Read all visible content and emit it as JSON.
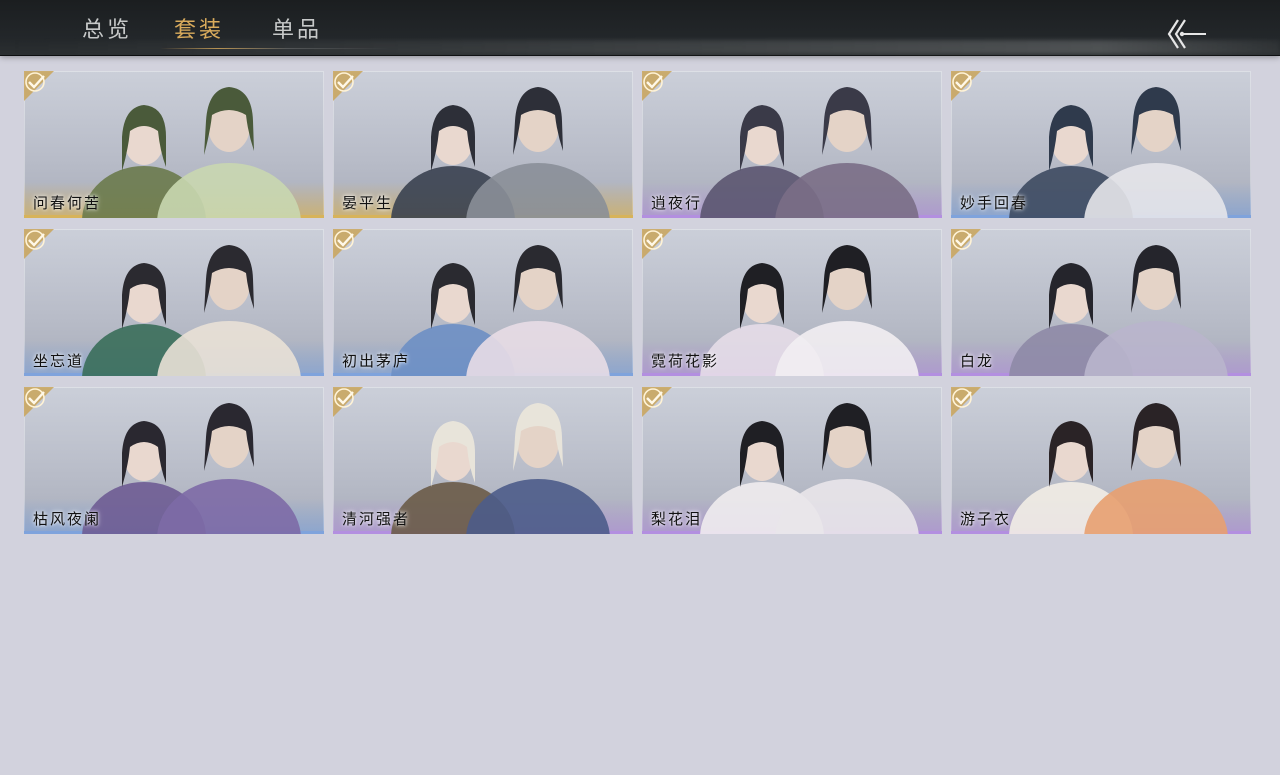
{
  "tabs": [
    {
      "label": "总览",
      "active": false
    },
    {
      "label": "套装",
      "active": true
    },
    {
      "label": "单品",
      "active": false
    }
  ],
  "back_icon": "double-chevron-left-arrow-icon",
  "colors": {
    "active_tab": "#d9ab5c",
    "inactive_tab": "#c7c9c9",
    "page_bg": "#d2d2dd",
    "topbar_bg": "#1b1e20",
    "quality_gold": "#d7b35a",
    "quality_purple": "#b38fe0",
    "quality_blue": "#7fa3dc",
    "check_badge": "#c9a55a"
  },
  "outfits": [
    {
      "name": "问春何苦",
      "quality": "gold",
      "owned": true
    },
    {
      "name": "晏平生",
      "quality": "gold",
      "owned": true
    },
    {
      "name": "逍夜行",
      "quality": "purple",
      "owned": true
    },
    {
      "name": "妙手回春",
      "quality": "blue",
      "owned": true
    },
    {
      "name": "坐忘道",
      "quality": "blue",
      "owned": true
    },
    {
      "name": "初出茅庐",
      "quality": "blue",
      "owned": true
    },
    {
      "name": "霓荷花影",
      "quality": "purple",
      "owned": true
    },
    {
      "name": "白龙",
      "quality": "purple",
      "owned": true
    },
    {
      "name": "枯风夜阑",
      "quality": "blue",
      "owned": true
    },
    {
      "name": "清河强者",
      "quality": "purple",
      "owned": true
    },
    {
      "name": "梨花泪",
      "quality": "purple",
      "owned": true
    },
    {
      "name": "游子衣",
      "quality": "purple",
      "owned": true
    }
  ]
}
